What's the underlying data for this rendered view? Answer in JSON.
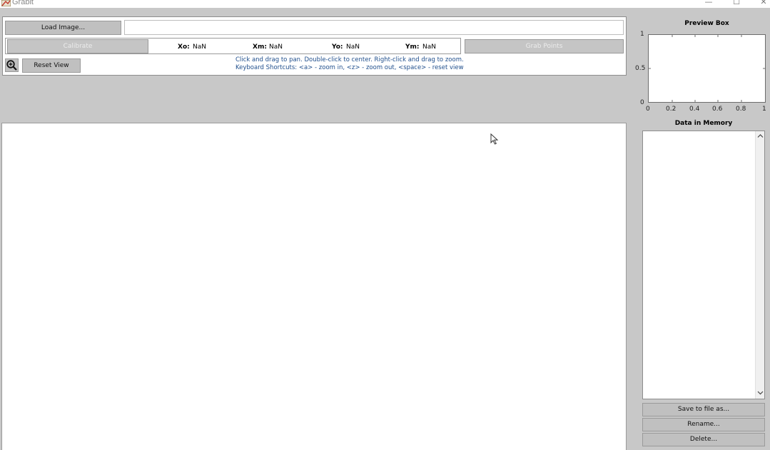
{
  "window": {
    "title": "Grabit",
    "minimize_glyph": "—",
    "maximize_glyph": "☐",
    "close_glyph": "✕"
  },
  "toolbar": {
    "load_label": "Load Image...",
    "filename_value": "",
    "calibrate_label": "Calibrate",
    "grab_label": "Grab Points",
    "reset_label": "Reset View"
  },
  "coords": {
    "xo_label": "Xo:",
    "xo_value": "NaN",
    "xm_label": "Xm:",
    "xm_value": "NaN",
    "yo_label": "Yo:",
    "yo_value": "NaN",
    "ym_label": "Ym:",
    "ym_value": "NaN"
  },
  "hints": {
    "line1": "Click and drag to pan. Double-click to center. Right-click and drag to zoom.",
    "line2": "Keyboard Shortcuts: <a> - zoom in, <z> - zoom out, <space> - reset view"
  },
  "preview": {
    "title": "Preview Box",
    "y_ticks": [
      "1",
      "0.5",
      "0"
    ],
    "x_ticks": [
      "0",
      "0.2",
      "0.4",
      "0.6",
      "0.8",
      "1"
    ]
  },
  "memory": {
    "title": "Data in Memory",
    "items": []
  },
  "actions": {
    "save_label": "Save to file as...",
    "rename_label": "Rename...",
    "delete_label": "Delete..."
  },
  "icons": {
    "app": "grabit-app-icon",
    "zoom": "zoom-in-icon",
    "cursor": "mouse-pointer-icon"
  },
  "colors": {
    "background": "#c8c8c8",
    "hint_text": "#1f4e8c",
    "button": "#c0c0c0"
  }
}
